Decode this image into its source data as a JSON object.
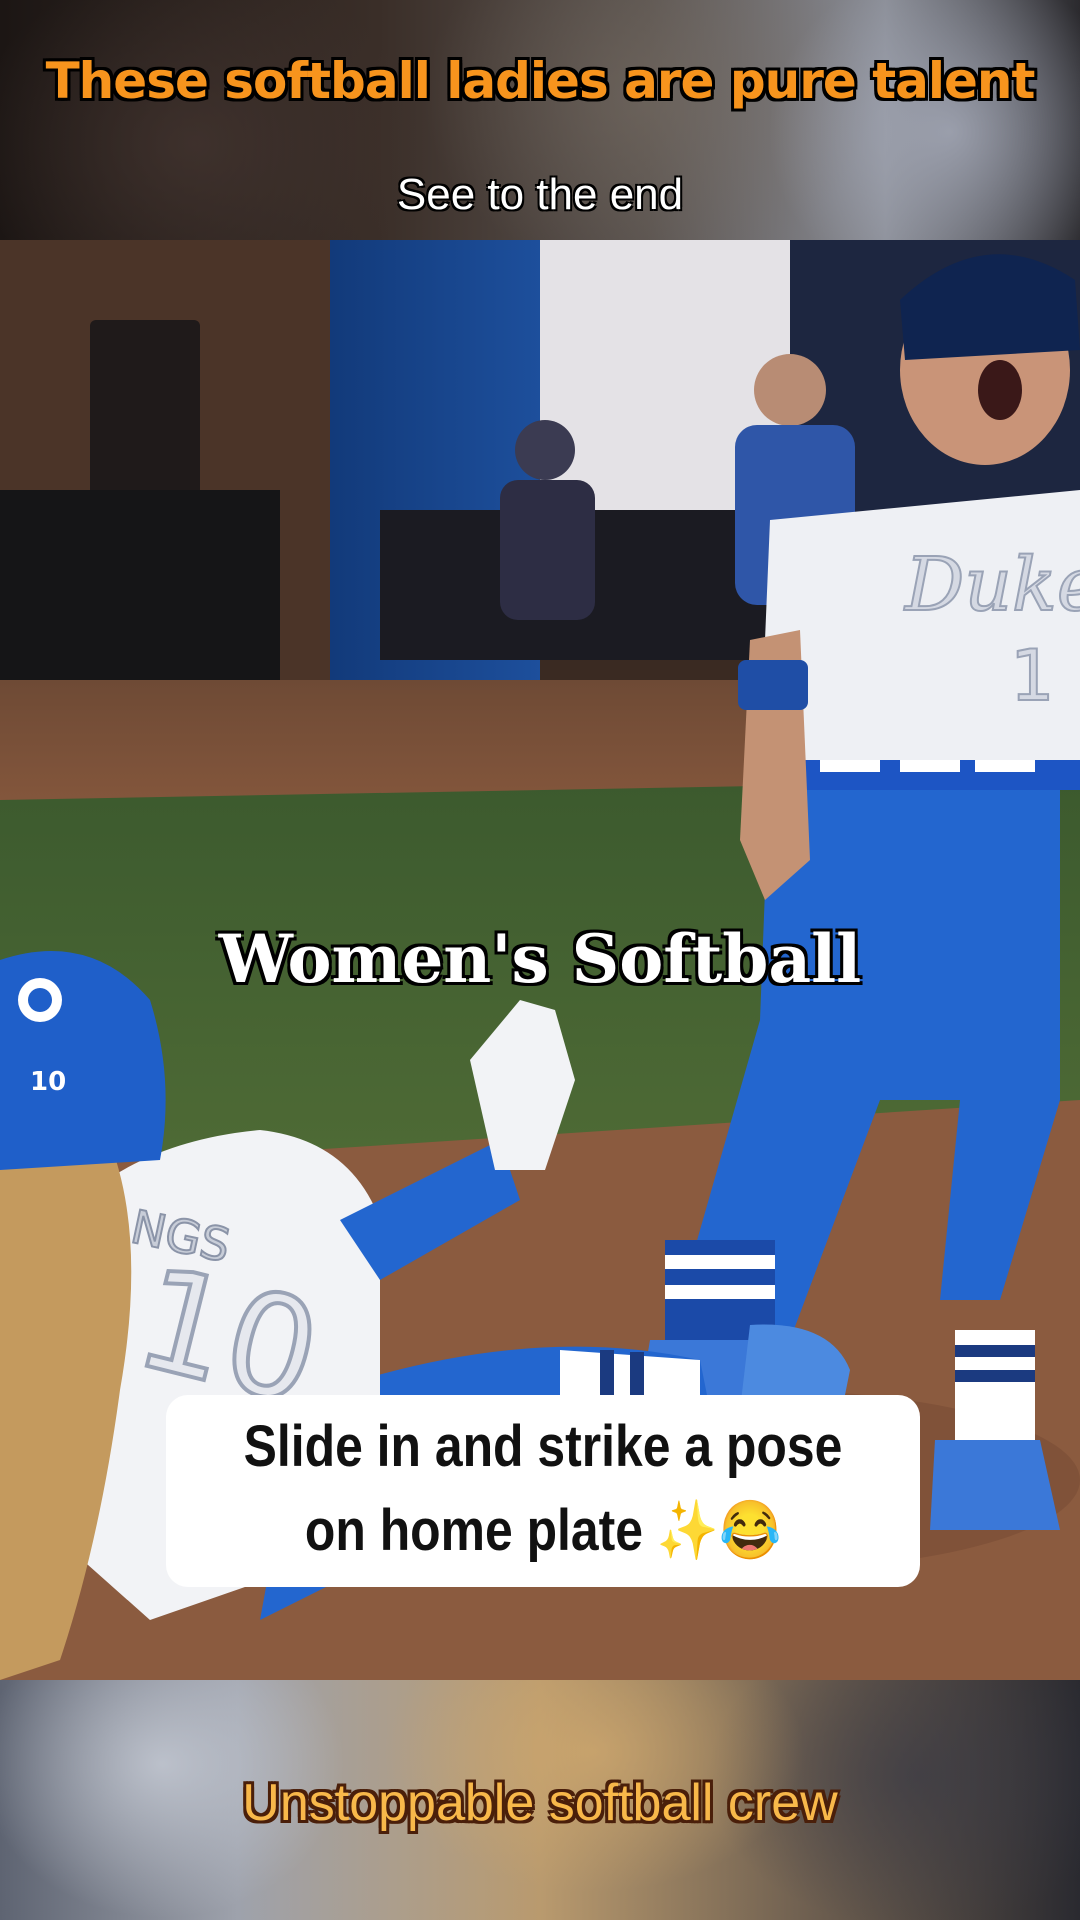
{
  "header": {
    "title": "These softball ladies are pure talent",
    "subtitle": "See to the end"
  },
  "video": {
    "overlay_title": "Women's Softball",
    "caption_line1": "Slide in and strike a pose",
    "caption_line2": "on home plate ✨😂",
    "jersey_text_left": "NGS",
    "jersey_number_left": "10",
    "helmet_number": "10",
    "jersey_text_right": "Duke",
    "jersey_number_right": "1"
  },
  "footer": {
    "title": "Unstoppable softball crew"
  },
  "colors": {
    "title_orange": "#f7941d",
    "footer_gold": "#f8b84a",
    "team_blue": "#1f5fc9"
  }
}
